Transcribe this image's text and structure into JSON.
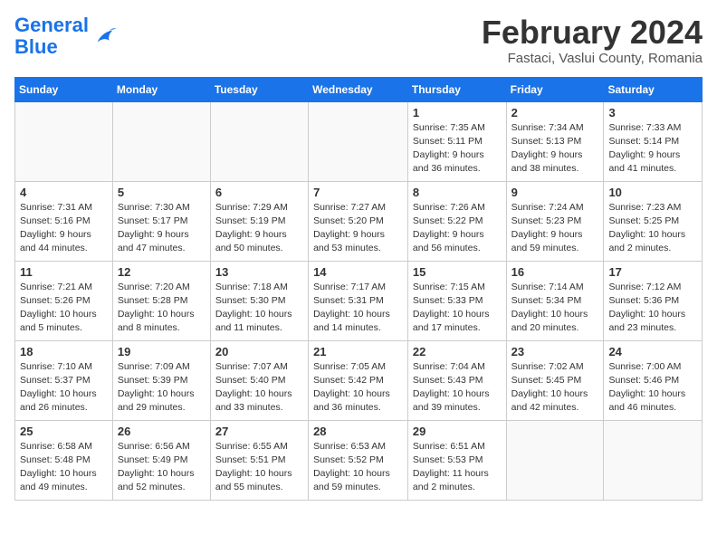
{
  "header": {
    "logo_line1": "General",
    "logo_line2": "Blue",
    "month": "February 2024",
    "location": "Fastaci, Vaslui County, Romania"
  },
  "weekdays": [
    "Sunday",
    "Monday",
    "Tuesday",
    "Wednesday",
    "Thursday",
    "Friday",
    "Saturday"
  ],
  "weeks": [
    [
      {
        "day": "",
        "info": ""
      },
      {
        "day": "",
        "info": ""
      },
      {
        "day": "",
        "info": ""
      },
      {
        "day": "",
        "info": ""
      },
      {
        "day": "1",
        "info": "Sunrise: 7:35 AM\nSunset: 5:11 PM\nDaylight: 9 hours and 36 minutes."
      },
      {
        "day": "2",
        "info": "Sunrise: 7:34 AM\nSunset: 5:13 PM\nDaylight: 9 hours and 38 minutes."
      },
      {
        "day": "3",
        "info": "Sunrise: 7:33 AM\nSunset: 5:14 PM\nDaylight: 9 hours and 41 minutes."
      }
    ],
    [
      {
        "day": "4",
        "info": "Sunrise: 7:31 AM\nSunset: 5:16 PM\nDaylight: 9 hours and 44 minutes."
      },
      {
        "day": "5",
        "info": "Sunrise: 7:30 AM\nSunset: 5:17 PM\nDaylight: 9 hours and 47 minutes."
      },
      {
        "day": "6",
        "info": "Sunrise: 7:29 AM\nSunset: 5:19 PM\nDaylight: 9 hours and 50 minutes."
      },
      {
        "day": "7",
        "info": "Sunrise: 7:27 AM\nSunset: 5:20 PM\nDaylight: 9 hours and 53 minutes."
      },
      {
        "day": "8",
        "info": "Sunrise: 7:26 AM\nSunset: 5:22 PM\nDaylight: 9 hours and 56 minutes."
      },
      {
        "day": "9",
        "info": "Sunrise: 7:24 AM\nSunset: 5:23 PM\nDaylight: 9 hours and 59 minutes."
      },
      {
        "day": "10",
        "info": "Sunrise: 7:23 AM\nSunset: 5:25 PM\nDaylight: 10 hours and 2 minutes."
      }
    ],
    [
      {
        "day": "11",
        "info": "Sunrise: 7:21 AM\nSunset: 5:26 PM\nDaylight: 10 hours and 5 minutes."
      },
      {
        "day": "12",
        "info": "Sunrise: 7:20 AM\nSunset: 5:28 PM\nDaylight: 10 hours and 8 minutes."
      },
      {
        "day": "13",
        "info": "Sunrise: 7:18 AM\nSunset: 5:30 PM\nDaylight: 10 hours and 11 minutes."
      },
      {
        "day": "14",
        "info": "Sunrise: 7:17 AM\nSunset: 5:31 PM\nDaylight: 10 hours and 14 minutes."
      },
      {
        "day": "15",
        "info": "Sunrise: 7:15 AM\nSunset: 5:33 PM\nDaylight: 10 hours and 17 minutes."
      },
      {
        "day": "16",
        "info": "Sunrise: 7:14 AM\nSunset: 5:34 PM\nDaylight: 10 hours and 20 minutes."
      },
      {
        "day": "17",
        "info": "Sunrise: 7:12 AM\nSunset: 5:36 PM\nDaylight: 10 hours and 23 minutes."
      }
    ],
    [
      {
        "day": "18",
        "info": "Sunrise: 7:10 AM\nSunset: 5:37 PM\nDaylight: 10 hours and 26 minutes."
      },
      {
        "day": "19",
        "info": "Sunrise: 7:09 AM\nSunset: 5:39 PM\nDaylight: 10 hours and 29 minutes."
      },
      {
        "day": "20",
        "info": "Sunrise: 7:07 AM\nSunset: 5:40 PM\nDaylight: 10 hours and 33 minutes."
      },
      {
        "day": "21",
        "info": "Sunrise: 7:05 AM\nSunset: 5:42 PM\nDaylight: 10 hours and 36 minutes."
      },
      {
        "day": "22",
        "info": "Sunrise: 7:04 AM\nSunset: 5:43 PM\nDaylight: 10 hours and 39 minutes."
      },
      {
        "day": "23",
        "info": "Sunrise: 7:02 AM\nSunset: 5:45 PM\nDaylight: 10 hours and 42 minutes."
      },
      {
        "day": "24",
        "info": "Sunrise: 7:00 AM\nSunset: 5:46 PM\nDaylight: 10 hours and 46 minutes."
      }
    ],
    [
      {
        "day": "25",
        "info": "Sunrise: 6:58 AM\nSunset: 5:48 PM\nDaylight: 10 hours and 49 minutes."
      },
      {
        "day": "26",
        "info": "Sunrise: 6:56 AM\nSunset: 5:49 PM\nDaylight: 10 hours and 52 minutes."
      },
      {
        "day": "27",
        "info": "Sunrise: 6:55 AM\nSunset: 5:51 PM\nDaylight: 10 hours and 55 minutes."
      },
      {
        "day": "28",
        "info": "Sunrise: 6:53 AM\nSunset: 5:52 PM\nDaylight: 10 hours and 59 minutes."
      },
      {
        "day": "29",
        "info": "Sunrise: 6:51 AM\nSunset: 5:53 PM\nDaylight: 11 hours and 2 minutes."
      },
      {
        "day": "",
        "info": ""
      },
      {
        "day": "",
        "info": ""
      }
    ]
  ]
}
